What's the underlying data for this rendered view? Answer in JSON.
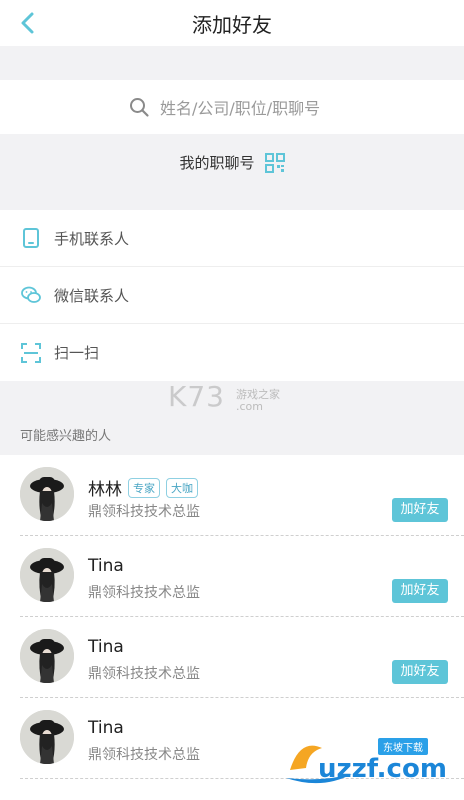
{
  "header": {
    "title": "添加好友"
  },
  "search": {
    "placeholder": "姓名/公司/职位/职聊号"
  },
  "my_id": {
    "label": "我的职聊号"
  },
  "menu": [
    {
      "label": "手机联系人",
      "icon": "phone-icon"
    },
    {
      "label": "微信联系人",
      "icon": "wechat-icon"
    },
    {
      "label": "扫一扫",
      "icon": "scan-icon"
    }
  ],
  "section": {
    "title": "可能感兴趣的人"
  },
  "people": [
    {
      "name": "林林",
      "tags": [
        "专家",
        "大咖"
      ],
      "job": "鼎领科技技术总监",
      "button": "加好友"
    },
    {
      "name": "Tina",
      "tags": [],
      "job": "鼎领科技技术总监",
      "button": "加好友"
    },
    {
      "name": "Tina",
      "tags": [],
      "job": "鼎领科技技术总监",
      "button": "加好友"
    },
    {
      "name": "Tina",
      "tags": [],
      "job": "鼎领科技技术总监",
      "button": ""
    }
  ],
  "watermark": {
    "main": "K73",
    "sub1": "游戏之家",
    "sub2": ".com"
  },
  "logo": {
    "text": "uzzf.com",
    "tag": "东坡下载"
  },
  "colors": {
    "accent": "#5ec5d8",
    "background": "#f2f2f4"
  }
}
